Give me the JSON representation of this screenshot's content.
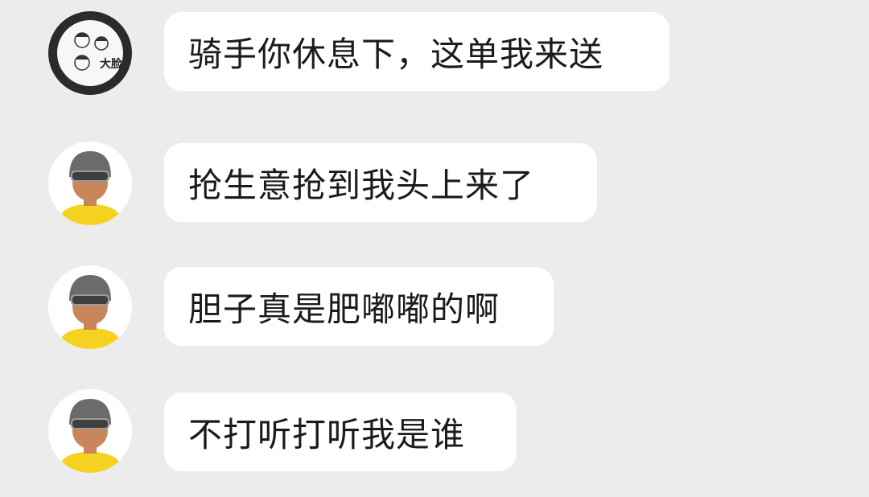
{
  "messages": [
    {
      "sender": "brand",
      "avatar": "brand-logo-avatar",
      "avatar_text": "大脸",
      "text": "骑手你休息下，这单我来送"
    },
    {
      "sender": "rider",
      "avatar": "rider-helmet-avatar",
      "text": "抢生意抢到我头上来了"
    },
    {
      "sender": "rider",
      "avatar": "rider-helmet-avatar",
      "text": "胆子真是肥嘟嘟的啊"
    },
    {
      "sender": "rider",
      "avatar": "rider-helmet-avatar",
      "text": "不打听打听我是谁"
    }
  ],
  "colors": {
    "background": "#ececec",
    "bubble": "#ffffff",
    "text": "#1b1b1b",
    "rider_shirt": "#f5d21f",
    "rider_helmet": "#6b6b6b",
    "rider_skin": "#c8865a"
  }
}
